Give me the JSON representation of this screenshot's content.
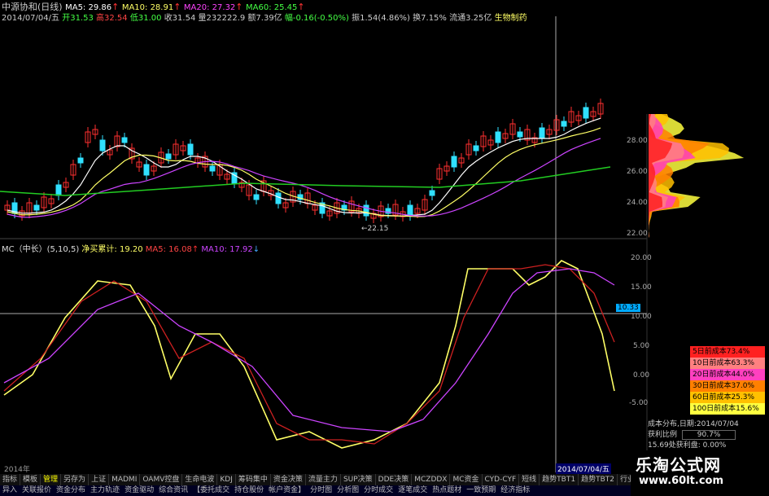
{
  "header": {
    "stock_title": "中源协和(日线)",
    "ma_lines": [
      {
        "label": "MA5: 29.86",
        "color": "#ffffff"
      },
      {
        "label": "MA10: 28.91",
        "color": "#ffff66"
      },
      {
        "label": "MA20: 27.32",
        "color": "#ff44ff"
      },
      {
        "label": "MA60: 25.45",
        "color": "#44ff44"
      }
    ],
    "info_date": "2014/07/04/五",
    "info_open": "开31.53",
    "info_high": "高32.54",
    "info_low": "低31.00",
    "info_close": "收31.54",
    "info_volume": "量232222.9",
    "info_amount": "额7.39亿",
    "info_change": "幅-0.16(-0.50%)",
    "info_amp": "振1.54(4.86%)",
    "info_turnover": "换7.15%",
    "info_float": "流通3.25亿",
    "info_sector": "生物制药"
  },
  "main_chart": {
    "price_axis_labels": [
      "28.00",
      "26.00",
      "24.00",
      "22.00"
    ],
    "low_marker": "←22.15"
  },
  "sub_chart": {
    "indicator_name": "MC（中长）(5,10,5)",
    "net_cum": "净买累计: 19.20",
    "ma5": "MA5: 16.08",
    "ma10": "MA10: 17.92",
    "y_labels": [
      "20.00",
      "15.00",
      "10.00",
      "5.00",
      "0.00",
      "-5.00"
    ],
    "current_value": "10.33"
  },
  "cost_legend": [
    {
      "label": "5日前成本73.4%",
      "color": "#ff2020"
    },
    {
      "label": "10日前成本63.3%",
      "color": "#ff8080"
    },
    {
      "label": "20日前成本44.0%",
      "color": "#ff40c0"
    },
    {
      "label": "30日前成本37.0%",
      "color": "#ff8000"
    },
    {
      "label": "60日前成本25.3%",
      "color": "#ffc000"
    },
    {
      "label": "100日前成本15.6%",
      "color": "#ffff40"
    }
  ],
  "cost_info": {
    "date_label": "成本分布,日期:",
    "date_value": "2014/07/04",
    "profit_label": "获利比例",
    "profit_value": "90.7%",
    "avg_label": "15.69处获利盘: 0.00%"
  },
  "time_axis": {
    "year": "2014年",
    "cursor_date": "2014/07/04/五"
  },
  "tabs": [
    "指标",
    "模板",
    "管理",
    "另存为",
    "上证",
    "MADMI",
    "OAMV控盘",
    "生命电波",
    "KDJ",
    "筹码集中",
    "资金决策",
    "流量主力",
    "SUP决策",
    "DDE决策",
    "MCZDDX",
    "MC资金",
    "CYD-CYF",
    "短线",
    "趋势TBT1",
    "趋势TBT2",
    "行业IC1",
    "行业IC2"
  ],
  "active_tab": "管理",
  "bottom_tabs": [
    "异入",
    "关联报价",
    "资金分布",
    "主力轨迹",
    "资金驱动",
    "综合资讯",
    "【委托成交",
    "持仓股份",
    "帐户资金】",
    "分时图",
    "分析图",
    "分时成交",
    "逐笔成交",
    "热点题材",
    "一致预期",
    "经济指标"
  ],
  "watermark": {
    "cn": "乐淘公式网",
    "url": "www.60lt.com"
  }
}
